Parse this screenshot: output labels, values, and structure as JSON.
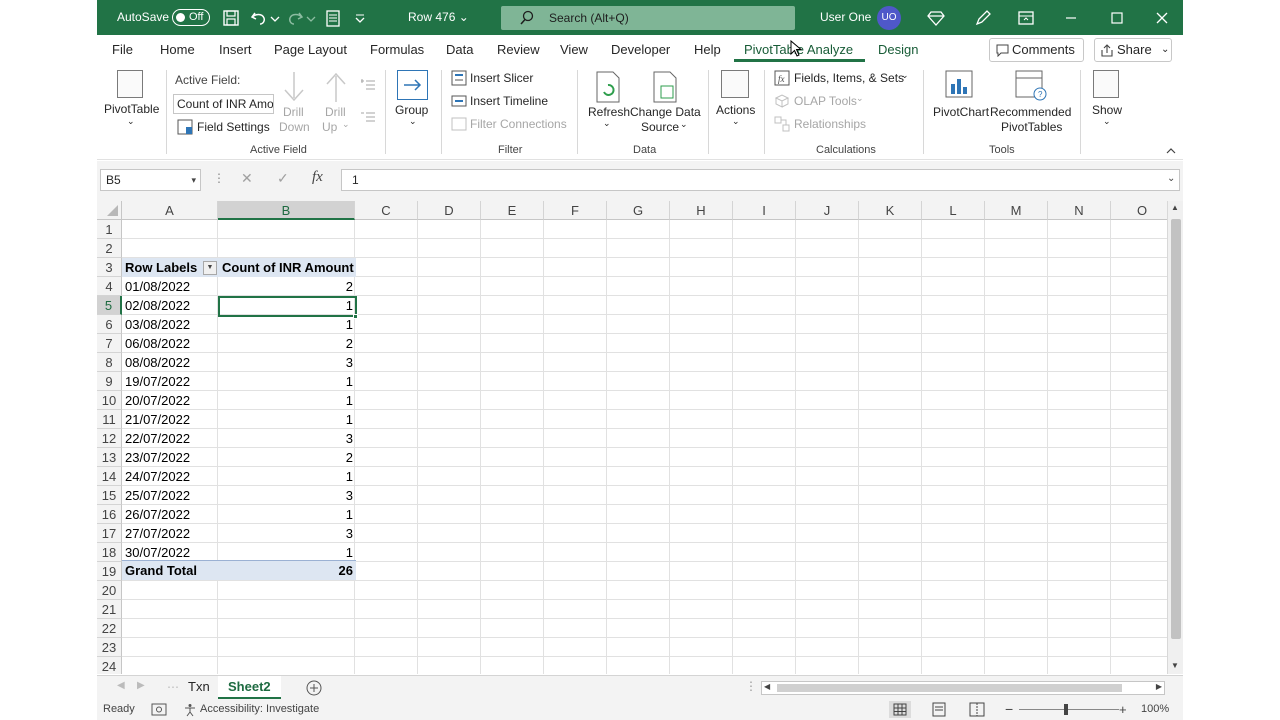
{
  "title_bar": {
    "autosave_label": "AutoSave",
    "autosave_state": "Off",
    "document_name": "Row 476",
    "search_placeholder": "Search (Alt+Q)",
    "user_name": "User One",
    "user_initials": "UO"
  },
  "menu": {
    "tabs": [
      "File",
      "Home",
      "Insert",
      "Page Layout",
      "Formulas",
      "Data",
      "Review",
      "View",
      "Developer",
      "Help",
      "PivotTable Analyze",
      "Design"
    ],
    "active_tab": "PivotTable Analyze",
    "comments_label": "Comments",
    "share_label": "Share"
  },
  "ribbon": {
    "pivottable": {
      "label": "PivotTable"
    },
    "active_field": {
      "label": "Active Field:",
      "value": "Count of INR Amo",
      "field_settings": "Field Settings",
      "drill_down": [
        "Drill",
        "Down"
      ],
      "drill_up": [
        "Drill",
        "Up"
      ],
      "group_label": "Active Field"
    },
    "group": {
      "label": "Group"
    },
    "filter": {
      "insert_slicer": "Insert Slicer",
      "insert_timeline": "Insert Timeline",
      "filter_connections": "Filter Connections",
      "group_label": "Filter"
    },
    "data": {
      "refresh": "Refresh",
      "change_data_source": [
        "Change Data",
        "Source"
      ],
      "group_label": "Data"
    },
    "actions": {
      "label": "Actions"
    },
    "calculations": {
      "fields_items_sets": "Fields, Items, & Sets",
      "olap_tools": "OLAP Tools",
      "relationships": "Relationships",
      "group_label": "Calculations"
    },
    "tools": {
      "pivotchart": "PivotChart",
      "recommended": [
        "Recommended",
        "PivotTables"
      ],
      "group_label": "Tools"
    },
    "show": {
      "label": "Show"
    }
  },
  "formula_bar": {
    "name_box": "B5",
    "cancel_glyph": "✕",
    "enter_glyph": "✓",
    "fx_label": "fx",
    "value": "1"
  },
  "grid": {
    "columns": [
      "A",
      "B",
      "C",
      "D",
      "E",
      "F",
      "G",
      "H",
      "I",
      "J",
      "K",
      "L",
      "M",
      "N",
      "O"
    ],
    "rows": [
      "1",
      "2",
      "3",
      "4",
      "5",
      "6",
      "7",
      "8",
      "9",
      "10",
      "11",
      "12",
      "13",
      "14",
      "15",
      "16",
      "17",
      "18",
      "19",
      "20",
      "21",
      "22",
      "23",
      "24"
    ],
    "selected_column": "B",
    "selected_row": "5",
    "pivot": {
      "header_row_labels": "Row Labels",
      "header_value": "Count of INR Amount",
      "items": [
        {
          "label": "01/08/2022",
          "value": "2"
        },
        {
          "label": "02/08/2022",
          "value": "1"
        },
        {
          "label": "03/08/2022",
          "value": "1"
        },
        {
          "label": "06/08/2022",
          "value": "2"
        },
        {
          "label": "08/08/2022",
          "value": "3"
        },
        {
          "label": "19/07/2022",
          "value": "1"
        },
        {
          "label": "20/07/2022",
          "value": "1"
        },
        {
          "label": "21/07/2022",
          "value": "1"
        },
        {
          "label": "22/07/2022",
          "value": "3"
        },
        {
          "label": "23/07/2022",
          "value": "2"
        },
        {
          "label": "24/07/2022",
          "value": "1"
        },
        {
          "label": "25/07/2022",
          "value": "3"
        },
        {
          "label": "26/07/2022",
          "value": "1"
        },
        {
          "label": "27/07/2022",
          "value": "3"
        },
        {
          "label": "30/07/2022",
          "value": "1"
        }
      ],
      "grand_total_label": "Grand Total",
      "grand_total_value": "26"
    }
  },
  "sheet_tabs": [
    "Txn",
    "Sheet2"
  ],
  "active_sheet": "Sheet2",
  "status_bar": {
    "mode": "Ready",
    "accessibility": "Accessibility: Investigate",
    "zoom": "100%"
  },
  "colors": {
    "accent": "#217346",
    "pivot_header": "#dde6f2"
  }
}
